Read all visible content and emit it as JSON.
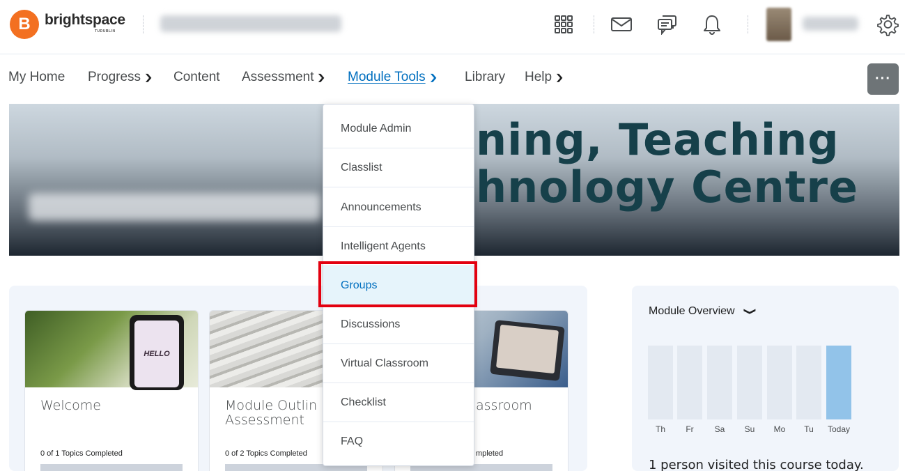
{
  "brand": {
    "logo_letter": "B",
    "name": "brightspace",
    "subtitle": "TUDUBLIN"
  },
  "nav": {
    "items": [
      {
        "label": "My Home",
        "chevron": false
      },
      {
        "label": "Progress",
        "chevron": true
      },
      {
        "label": "Content",
        "chevron": false
      },
      {
        "label": "Assessment",
        "chevron": true
      },
      {
        "label": "Module Tools",
        "chevron": true
      },
      {
        "label": "Library",
        "chevron": false
      },
      {
        "label": "Help",
        "chevron": true
      }
    ],
    "more_label": "···",
    "active": "Module Tools"
  },
  "banner": {
    "title_line1": "ning, Teaching",
    "title_line2": "hnology Centre"
  },
  "dropdown": {
    "items": [
      "Module Admin",
      "Classlist",
      "Announcements",
      "Intelligent Agents",
      "Groups",
      "Discussions",
      "Virtual Classroom",
      "Checklist",
      "FAQ"
    ],
    "selected": "Groups"
  },
  "cards": [
    {
      "title": "Welcome",
      "title2": "",
      "progress": "0 of 1 Topics Completed",
      "image": "HELLO"
    },
    {
      "title": "Module Outlin",
      "title2": "Assessment",
      "progress": "0 of 2 Topics Completed",
      "image": ""
    },
    {
      "title": "assroom",
      "title2": "",
      "progress": "mpleted",
      "image": ""
    }
  ],
  "overview": {
    "title": "Module Overview",
    "days": [
      "Th",
      "Fr",
      "Sa",
      "Su",
      "Mo",
      "Tu",
      "Today"
    ],
    "visits_text": "1 person visited this course today."
  },
  "colors": {
    "accent": "#006fbf",
    "brand_orange": "#f37021",
    "highlight_red": "#e3000f",
    "selected_bg": "#e6f4fb"
  }
}
